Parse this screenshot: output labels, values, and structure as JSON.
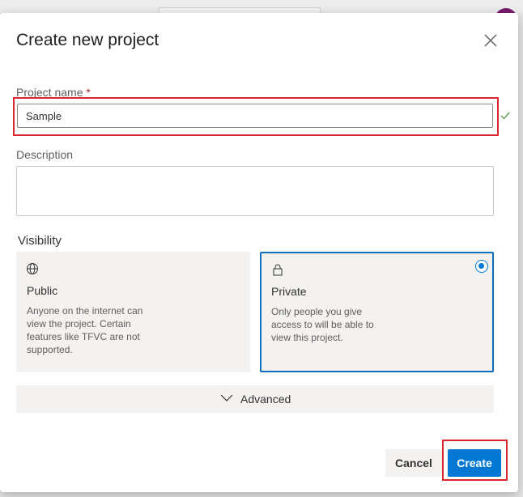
{
  "dialog": {
    "title": "Create new project",
    "close_icon": "close-icon"
  },
  "project_name": {
    "label": "Project name",
    "required_marker": "*",
    "value": "Sample",
    "valid_icon": "checkmark-icon"
  },
  "description": {
    "label": "Description",
    "value": ""
  },
  "visibility": {
    "label": "Visibility",
    "options": [
      {
        "icon": "globe-icon",
        "title": "Public",
        "description": "Anyone on the internet can view the project. Certain features like TFVC are not supported.",
        "selected": false
      },
      {
        "icon": "lock-icon",
        "title": "Private",
        "description": "Only people you give access to will be able to view this project.",
        "selected": true
      }
    ]
  },
  "advanced": {
    "label": "Advanced",
    "icon": "chevron-down-icon"
  },
  "footer": {
    "cancel_label": "Cancel",
    "create_label": "Create"
  },
  "colors": {
    "accent": "#0078d4",
    "highlight": "#d7262e",
    "avatar": "#7a1b6e"
  }
}
